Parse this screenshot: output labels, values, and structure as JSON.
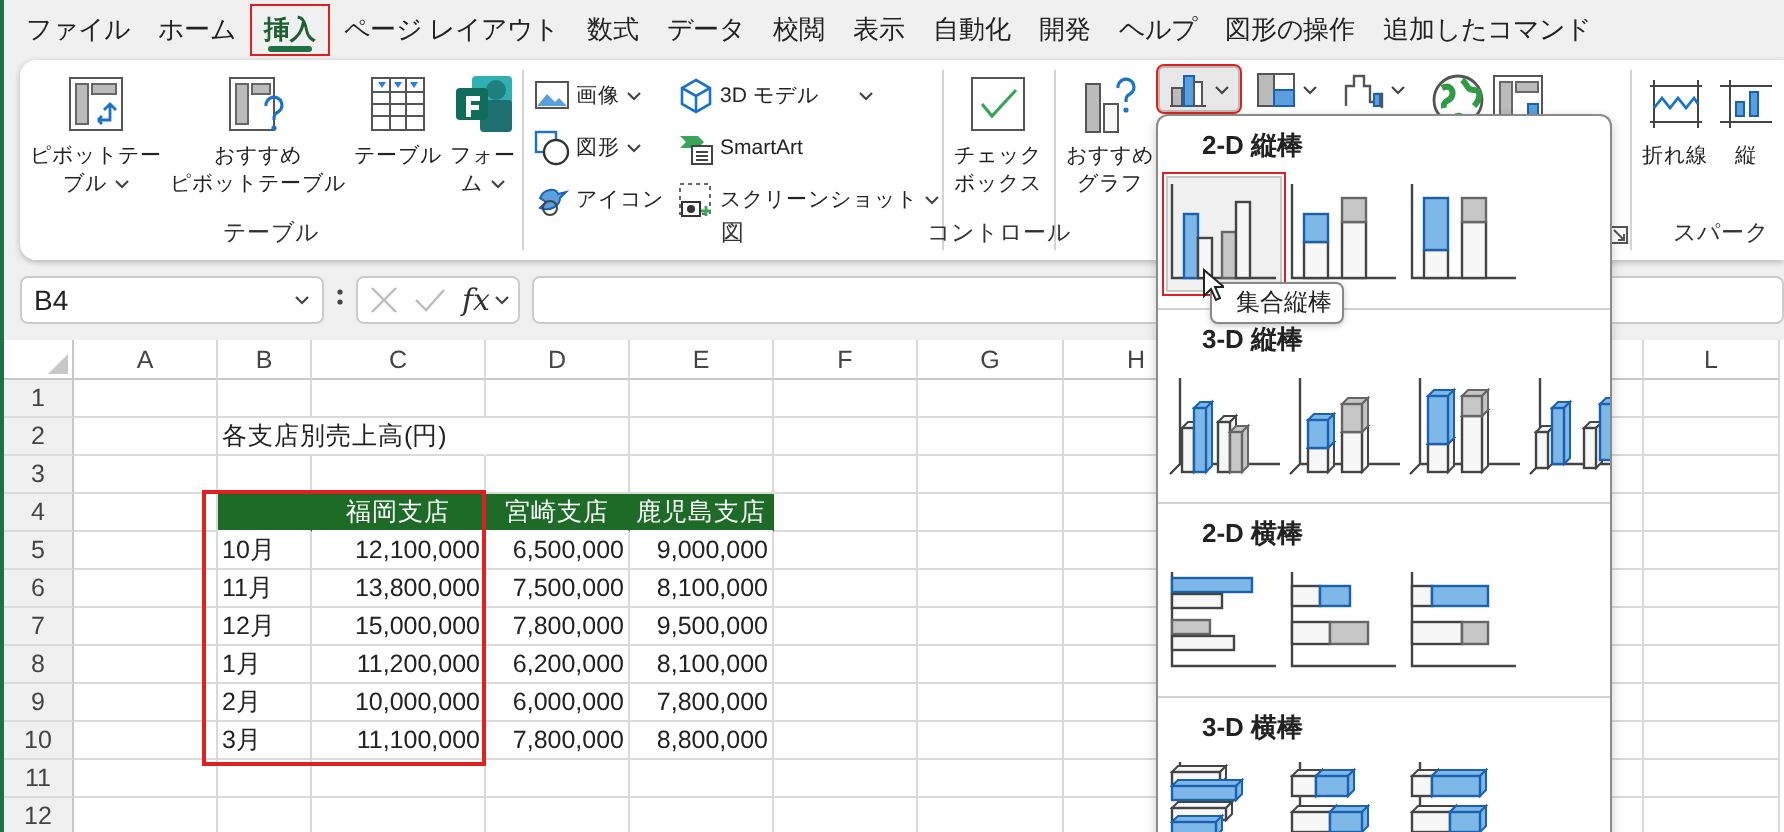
{
  "menu_tabs": [
    {
      "label": "ファイル",
      "selected": false,
      "highlighted": false
    },
    {
      "label": "ホーム",
      "selected": false,
      "highlighted": false
    },
    {
      "label": "挿入",
      "selected": true,
      "highlighted": true
    },
    {
      "label": "ページ レイアウト",
      "selected": false,
      "highlighted": false
    },
    {
      "label": "数式",
      "selected": false,
      "highlighted": false
    },
    {
      "label": "データ",
      "selected": false,
      "highlighted": false
    },
    {
      "label": "校閲",
      "selected": false,
      "highlighted": false
    },
    {
      "label": "表示",
      "selected": false,
      "highlighted": false
    },
    {
      "label": "自動化",
      "selected": false,
      "highlighted": false
    },
    {
      "label": "開発",
      "selected": false,
      "highlighted": false
    },
    {
      "label": "ヘルプ",
      "selected": false,
      "highlighted": false
    },
    {
      "label": "図形の操作",
      "selected": false,
      "highlighted": false
    },
    {
      "label": "追加したコマンド",
      "selected": false,
      "highlighted": false
    }
  ],
  "ribbon": {
    "groups": [
      {
        "label": "テーブル",
        "kind": "large",
        "buttons": [
          {
            "kind": "pivot",
            "lines": [
              "ピボットテー",
              "ブル"
            ],
            "dropdown": true
          },
          {
            "kind": "recommended-pivot",
            "lines": [
              "おすすめ",
              "ピボットテーブル"
            ],
            "dropdown": false
          },
          {
            "kind": "table",
            "lines": [
              "テーブル"
            ],
            "dropdown": false
          },
          {
            "kind": "forms",
            "lines": [
              "フォー",
              "ム"
            ],
            "dropdown": true
          }
        ]
      },
      {
        "label": "図",
        "kind": "small",
        "buttons": [
          {
            "kind": "image",
            "label": "画像",
            "dropdown": true
          },
          {
            "kind": "shapes",
            "label": "図形",
            "dropdown": true
          },
          {
            "kind": "icons",
            "label": "アイコン",
            "dropdown": false
          },
          {
            "kind": "model3d",
            "label": "3D モデル",
            "dropdown": true
          },
          {
            "kind": "smartart",
            "label": "SmartArt",
            "dropdown": false
          },
          {
            "kind": "screenshot",
            "label": "スクリーンショット",
            "dropdown": true
          }
        ]
      },
      {
        "label": "コントロール",
        "kind": "large",
        "buttons": [
          {
            "kind": "checkbox",
            "lines": [
              "チェック",
              "ボックス"
            ],
            "dropdown": false
          }
        ]
      },
      {
        "kind": "charts",
        "buttons": [
          {
            "kind": "recommended-chart",
            "lines": [
              "おすすめ",
              "グラフ"
            ],
            "dropdown": false
          },
          {
            "kind": "column-chart",
            "dropdown": true,
            "expanded": true,
            "highlighted": true
          },
          {
            "kind": "hierarchy-chart",
            "dropdown": true,
            "expanded": false,
            "highlighted": false
          },
          {
            "kind": "waterfall-chart",
            "dropdown": true,
            "expanded": false,
            "highlighted": false
          },
          {
            "kind": "map-chart",
            "dropdown": false
          },
          {
            "kind": "pivot-chart",
            "dropdown": false
          }
        ]
      },
      {
        "label": "スパーク",
        "kind": "large",
        "buttons": [
          {
            "kind": "sparkline-line",
            "lines": [
              "折れ線"
            ],
            "dropdown": false
          },
          {
            "kind": "sparkline-column",
            "lines": [
              "縦"
            ],
            "dropdown": false
          }
        ]
      }
    ]
  },
  "formula_bar": {
    "name_box": "B4",
    "function_label": "fx"
  },
  "sheet": {
    "columns": [
      "A",
      "B",
      "C",
      "D",
      "E",
      "F",
      "G",
      "H",
      "L"
    ],
    "rows": [
      "1",
      "2",
      "3",
      "4",
      "5",
      "6",
      "7",
      "8",
      "9",
      "10",
      "11",
      "12"
    ],
    "title": "各支店別売上高(円)",
    "table": {
      "months": [
        "10月",
        "11月",
        "12月",
        "1月",
        "2月",
        "3月"
      ],
      "stores": [
        {
          "name": "福岡支店",
          "highlighted": true,
          "values": [
            "12,100,000",
            "13,800,000",
            "15,000,000",
            "11,200,000",
            "10,000,000",
            "11,100,000"
          ]
        },
        {
          "name": "宮崎支店",
          "highlighted": false,
          "values": [
            "6,500,000",
            "7,500,000",
            "7,800,000",
            "6,200,000",
            "6,000,000",
            "7,800,000"
          ]
        },
        {
          "name": "鹿児島支店",
          "highlighted": false,
          "values": [
            "9,000,000",
            "8,100,000",
            "9,500,000",
            "8,100,000",
            "7,800,000",
            "8,800,000"
          ]
        }
      ]
    }
  },
  "chart_menu": {
    "tooltip": "集合縦棒",
    "sections": [
      {
        "title": "2-D 縦棒",
        "kind": "column-2d",
        "options": [
          {
            "selected": true,
            "highlighted": true
          },
          {
            "selected": false,
            "highlighted": false
          },
          {
            "selected": false,
            "highlighted": false
          }
        ]
      },
      {
        "title": "3-D 縦棒",
        "kind": "column-3d",
        "options": [
          {
            "selected": false,
            "highlighted": false
          },
          {
            "selected": false,
            "highlighted": false
          },
          {
            "selected": false,
            "highlighted": false
          },
          {
            "selected": false,
            "highlighted": false
          }
        ]
      },
      {
        "title": "2-D 横棒",
        "kind": "bar-2d",
        "options": [
          {
            "selected": false,
            "highlighted": false
          },
          {
            "selected": false,
            "highlighted": false
          },
          {
            "selected": false,
            "highlighted": false
          }
        ]
      },
      {
        "title": "3-D 横棒",
        "kind": "bar-3d",
        "options": [
          {
            "selected": false,
            "highlighted": false
          },
          {
            "selected": false,
            "highlighted": false
          },
          {
            "selected": false,
            "highlighted": false
          }
        ]
      }
    ]
  }
}
